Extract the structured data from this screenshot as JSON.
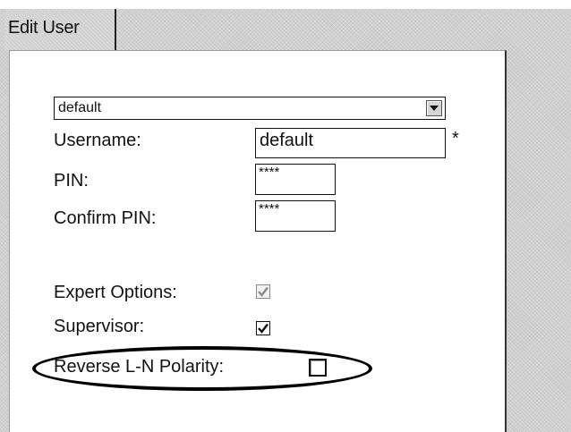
{
  "tab": {
    "label": "Edit User"
  },
  "user_select": {
    "value": "default"
  },
  "form": {
    "username_label": "Username:",
    "username_value": "default",
    "required_marker": "*",
    "pin_label": "PIN:",
    "pin_value": "****",
    "confirm_pin_label": "Confirm PIN:",
    "confirm_pin_value": "****",
    "expert_options_label": "Expert Options:",
    "expert_options_checked": true,
    "expert_options_enabled": false,
    "supervisor_label": "Supervisor:",
    "supervisor_checked": true,
    "reverse_polarity_label": "Reverse L-N Polarity:",
    "reverse_polarity_checked": false
  },
  "icons": {
    "dropdown": "chevron-down-icon",
    "check": "checkmark-icon"
  }
}
